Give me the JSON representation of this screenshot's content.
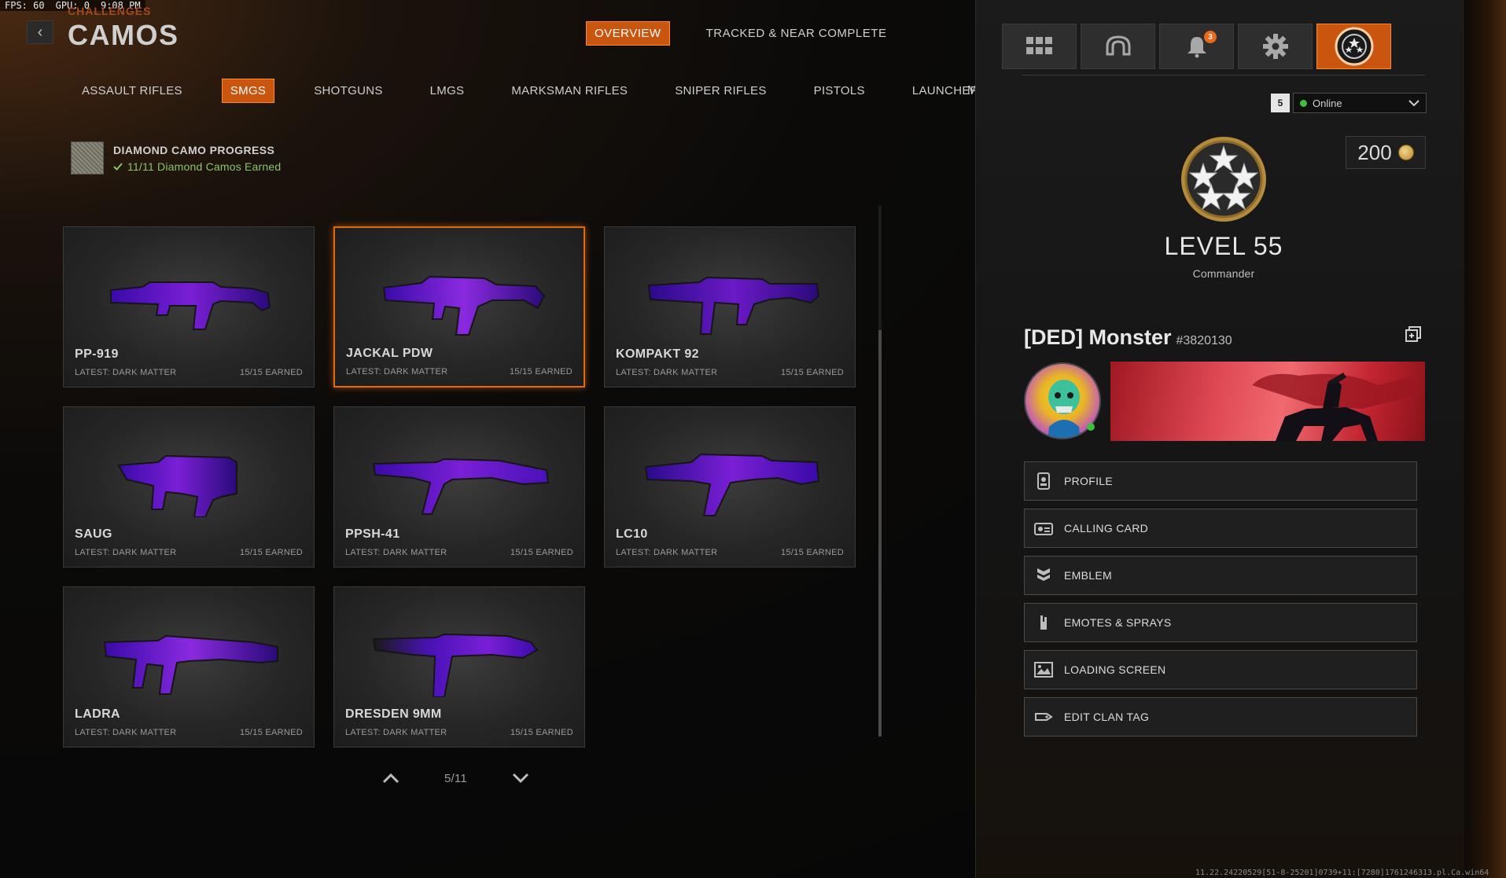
{
  "debug": {
    "fps_label": "FPS:",
    "fps": "60",
    "gpu_label": "GPU:",
    "gpu": "0",
    "time": "9:08 PM"
  },
  "header": {
    "breadcrumb": "CHALLENGES",
    "title": "CAMOS",
    "back_icon": "chevron-left-icon",
    "top_tabs": [
      {
        "label": "OVERVIEW",
        "active": true
      },
      {
        "label": "TRACKED & NEAR COMPLETE",
        "active": false
      }
    ]
  },
  "categories": [
    {
      "label": "ASSAULT RIFLES",
      "active": false
    },
    {
      "label": "SMGS",
      "active": true
    },
    {
      "label": "SHOTGUNS",
      "active": false
    },
    {
      "label": "LMGS",
      "active": false
    },
    {
      "label": "MARKSMAN RIFLES",
      "active": false
    },
    {
      "label": "SNIPER RIFLES",
      "active": false
    },
    {
      "label": "PISTOLS",
      "active": false
    },
    {
      "label": "LAUNCHERS & SPECIALS",
      "active": false
    }
  ],
  "categories_cutoff": "M",
  "progress": {
    "title": "DIAMOND CAMO PROGRESS",
    "status": "11/11 Diamond Camos Earned"
  },
  "weapons": [
    {
      "name": "PP-919",
      "latest": "LATEST: DARK MATTER",
      "earned": "15/15 EARNED",
      "selected": false
    },
    {
      "name": "JACKAL PDW",
      "latest": "LATEST: DARK MATTER",
      "earned": "15/15 EARNED",
      "selected": true
    },
    {
      "name": "KOMPAKT 92",
      "latest": "LATEST: DARK MATTER",
      "earned": "15/15 EARNED",
      "selected": false
    },
    {
      "name": "SAUG",
      "latest": "LATEST: DARK MATTER",
      "earned": "15/15 EARNED",
      "selected": false
    },
    {
      "name": "PPSH-41",
      "latest": "LATEST: DARK MATTER",
      "earned": "15/15 EARNED",
      "selected": false
    },
    {
      "name": "LC10",
      "latest": "LATEST: DARK MATTER",
      "earned": "15/15 EARNED",
      "selected": false
    },
    {
      "name": "LADRA",
      "latest": "LATEST: DARK MATTER",
      "earned": "15/15 EARNED",
      "selected": false
    },
    {
      "name": "DRESDEN 9MM",
      "latest": "LATEST: DARK MATTER",
      "earned": "15/15 EARNED",
      "selected": false
    }
  ],
  "pager": {
    "page": "5/11"
  },
  "panel": {
    "icons": [
      {
        "name": "grid-icon",
        "active": false
      },
      {
        "name": "headset-icon",
        "active": false
      },
      {
        "name": "bell-icon",
        "active": false,
        "badge": "3"
      },
      {
        "name": "gear-icon",
        "active": false
      },
      {
        "name": "rank-icon",
        "active": true
      }
    ],
    "party_size": "5",
    "status": "Online",
    "currency": "200",
    "level": "LEVEL 55",
    "rank_title": "Commander",
    "gamertag": "[DED] Monster",
    "gamer_id": "#3820130",
    "menu": [
      {
        "label": "PROFILE",
        "icon": "id-badge-icon"
      },
      {
        "label": "CALLING CARD",
        "icon": "calling-card-icon"
      },
      {
        "label": "EMBLEM",
        "icon": "emblem-icon"
      },
      {
        "label": "EMOTES & SPRAYS",
        "icon": "emote-icon"
      },
      {
        "label": "LOADING SCREEN",
        "icon": "loading-screen-icon"
      },
      {
        "label": "EDIT CLAN TAG",
        "icon": "clan-tag-icon"
      }
    ]
  },
  "footer": {
    "build_id": "11.22.24220529[51-8-25201]0739+11:[7280]1761246313.pl.Ca.win64"
  }
}
